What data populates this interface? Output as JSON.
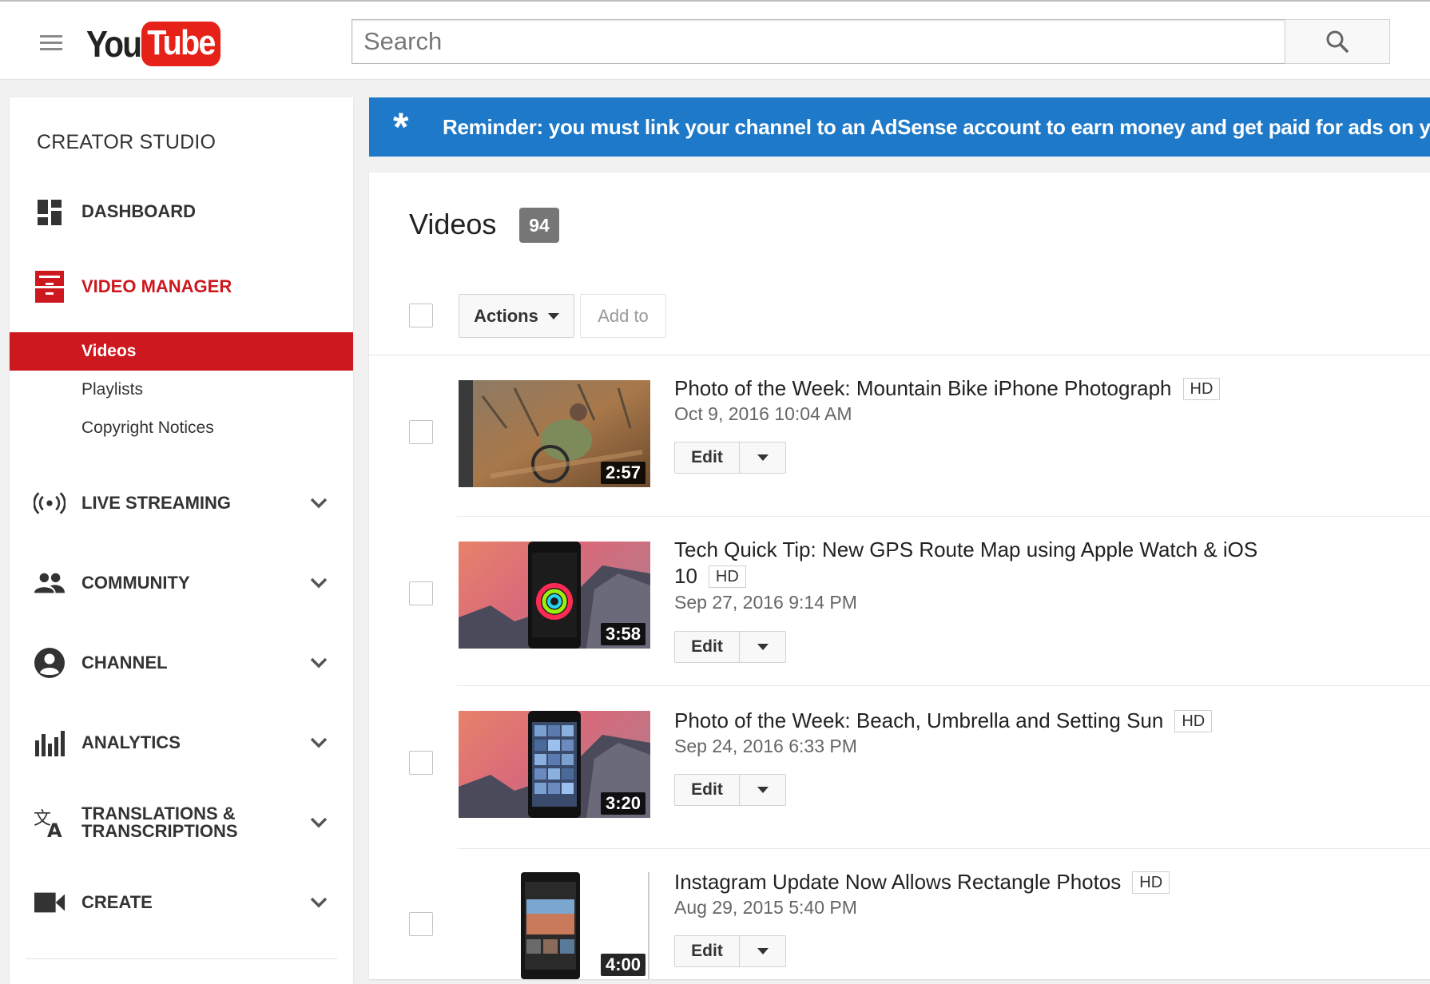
{
  "header": {
    "logo_you": "You",
    "logo_tube": "Tube",
    "search_placeholder": "Search"
  },
  "sidebar": {
    "title": "CREATOR STUDIO",
    "items": [
      {
        "label": "DASHBOARD",
        "icon": "dashboard-icon"
      },
      {
        "label": "VIDEO MANAGER",
        "icon": "video-manager-icon",
        "active": true
      },
      {
        "label": "LIVE STREAMING",
        "icon": "live-streaming-icon"
      },
      {
        "label": "COMMUNITY",
        "icon": "community-icon"
      },
      {
        "label": "CHANNEL",
        "icon": "channel-icon"
      },
      {
        "label": "ANALYTICS",
        "icon": "analytics-icon"
      },
      {
        "label_line1": "TRANSLATIONS &",
        "label_line2": "TRANSCRIPTIONS",
        "icon": "translate-icon"
      },
      {
        "label": "CREATE",
        "icon": "create-icon"
      }
    ],
    "sub_items": [
      {
        "label": "Videos",
        "selected": true
      },
      {
        "label": "Playlists"
      },
      {
        "label": "Copyright Notices"
      }
    ]
  },
  "banner": {
    "icon": "asterisk-icon",
    "text": "Reminder: you must link your channel to an AdSense account to earn money and get paid for ads on your vi"
  },
  "main": {
    "title": "Videos",
    "count": "94",
    "actions_label": "Actions",
    "add_to_label": "Add to"
  },
  "videos": [
    {
      "title": "Photo of the Week: Mountain Bike iPhone Photograph",
      "title_line2": "",
      "quality": "HD",
      "date": "Oct 9, 2016 10:04 AM",
      "duration": "2:57",
      "edit_label": "Edit"
    },
    {
      "title": "Tech Quick Tip: New GPS Route Map using Apple Watch & iOS",
      "title_line2": "10",
      "quality": "HD",
      "date": "Sep 27, 2016 9:14 PM",
      "duration": "3:58",
      "edit_label": "Edit"
    },
    {
      "title": "Photo of the Week: Beach, Umbrella and Setting Sun",
      "title_line2": "",
      "quality": "HD",
      "date": "Sep 24, 2016 6:33 PM",
      "duration": "3:20",
      "edit_label": "Edit"
    },
    {
      "title": "Instagram Update Now Allows Rectangle Photos",
      "title_line2": "",
      "quality": "HD",
      "date": "Aug 29, 2015 5:40 PM",
      "duration": "4:00",
      "edit_label": "Edit"
    }
  ],
  "colors": {
    "brand_red": "#cc181e",
    "banner_blue": "#1e79c8",
    "badge_gray": "#767676"
  }
}
